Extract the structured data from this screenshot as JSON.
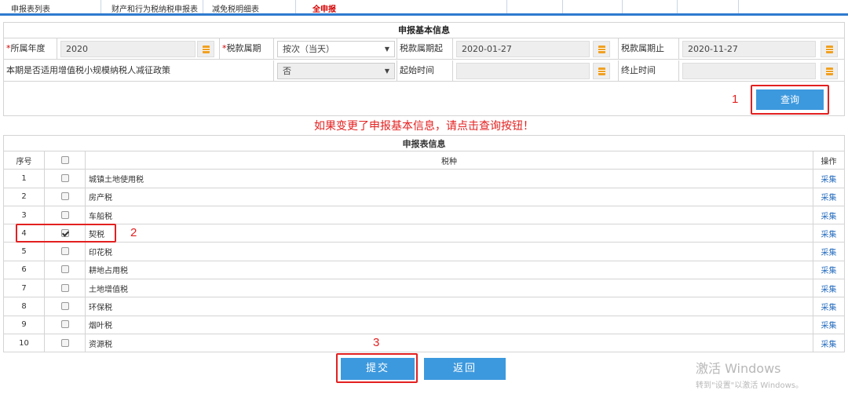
{
  "tabs": [
    {
      "label": "申报表列表",
      "active": false
    },
    {
      "label": "财产和行为税纳税申报表",
      "active": false
    },
    {
      "label": "减免税明细表",
      "active": false
    },
    {
      "label": "全申报",
      "active": true
    }
  ],
  "basic_info": {
    "title": "申报基本信息",
    "year_label": "所属年度",
    "year_value": "2020",
    "period_label": "税款属期",
    "period_value": "按次（当天）",
    "period_start_label": "税款属期起",
    "period_start_value": "2020-01-27",
    "period_end_label": "税款属期止",
    "period_end_value": "2020-11-27",
    "policy_label": "本期是否适用增值税小规模纳税人减征政策",
    "policy_value": "否",
    "begin_time_label": "起始时间",
    "begin_time_value": "",
    "end_time_label": "终止时间",
    "end_time_value": ""
  },
  "query_button": "查询",
  "hint": "如果变更了申报基本信息，请点击查询按钮！",
  "decl_table": {
    "title": "申报表信息",
    "headers": {
      "no": "序号",
      "tax": "税种",
      "op": "操作"
    },
    "rows": [
      {
        "no": "1",
        "tax": "城镇土地使用税",
        "checked": false,
        "op": "采集"
      },
      {
        "no": "2",
        "tax": "房产税",
        "checked": false,
        "op": "采集"
      },
      {
        "no": "3",
        "tax": "车船税",
        "checked": false,
        "op": "采集"
      },
      {
        "no": "4",
        "tax": "契税",
        "checked": true,
        "op": "采集"
      },
      {
        "no": "5",
        "tax": "印花税",
        "checked": false,
        "op": "采集"
      },
      {
        "no": "6",
        "tax": "耕地占用税",
        "checked": false,
        "op": "采集"
      },
      {
        "no": "7",
        "tax": "土地增值税",
        "checked": false,
        "op": "采集"
      },
      {
        "no": "8",
        "tax": "环保税",
        "checked": false,
        "op": "采集"
      },
      {
        "no": "9",
        "tax": "烟叶税",
        "checked": false,
        "op": "采集"
      },
      {
        "no": "10",
        "tax": "资源税",
        "checked": false,
        "op": "采集"
      }
    ]
  },
  "submit_button": "提交",
  "back_button": "返回",
  "annotations": {
    "a1": "1",
    "a2": "2",
    "a3": "3"
  },
  "watermark": {
    "line1": "激活 Windows",
    "line2": "转到\"设置\"以激活 Windows。"
  },
  "colors": {
    "accent": "#3d99de",
    "annotation": "#e32020",
    "tab_border": "#2e7bcf",
    "link": "#2a6fbf"
  }
}
